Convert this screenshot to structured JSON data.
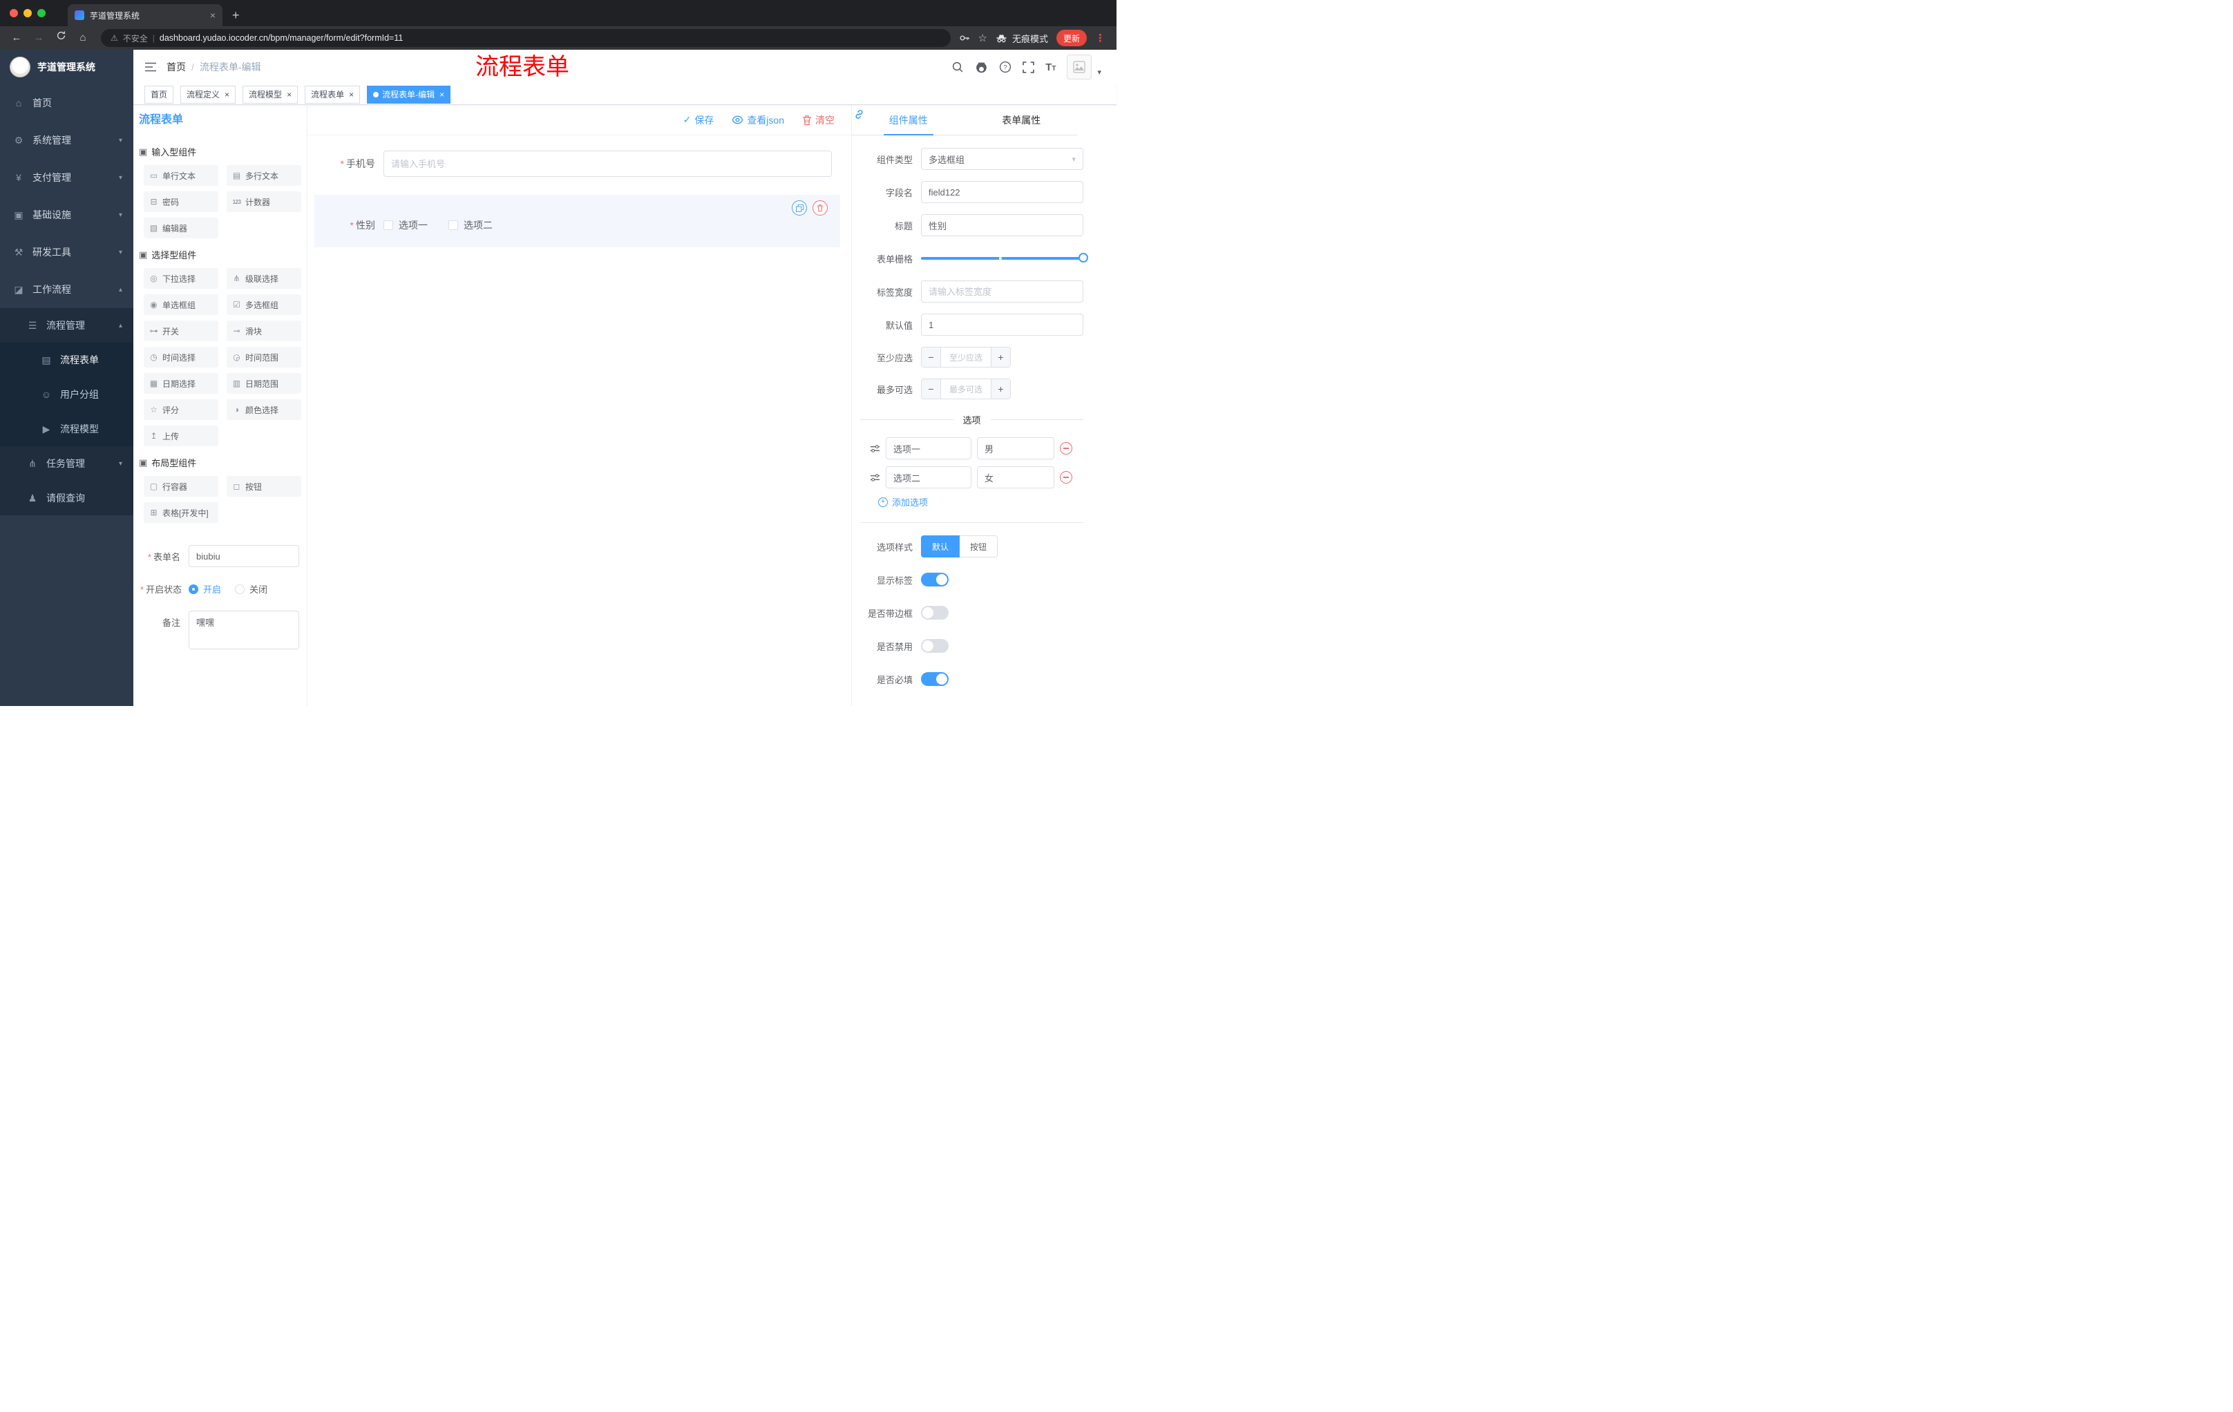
{
  "browser": {
    "tab_title": "芋道管理系统",
    "security_label": "不安全",
    "url": "dashboard.yudao.iocoder.cn/bpm/manager/form/edit?formId=11",
    "incognito_label": "无痕模式",
    "update_label": "更新"
  },
  "sidebar": {
    "logo_title": "芋道管理系统",
    "menu": [
      {
        "label": "首页",
        "icon": "⌂"
      },
      {
        "label": "系统管理",
        "icon": "⚙"
      },
      {
        "label": "支付管理",
        "icon": "¥"
      },
      {
        "label": "基础设施",
        "icon": "▣"
      },
      {
        "label": "研发工具",
        "icon": "⚒"
      },
      {
        "label": "工作流程",
        "icon": "◪"
      },
      {
        "label": "流程管理",
        "icon": "☰"
      },
      {
        "label": "流程表单",
        "icon": "▤"
      },
      {
        "label": "用户分组",
        "icon": "☺"
      },
      {
        "label": "流程模型",
        "icon": "▶"
      },
      {
        "label": "任务管理",
        "icon": "⋔"
      },
      {
        "label": "请假查询",
        "icon": "♟"
      }
    ]
  },
  "header": {
    "breadcrumb_home": "首页",
    "breadcrumb_current": "流程表单-编辑",
    "overlay_text": "流程表单"
  },
  "tags": [
    {
      "label": "首页"
    },
    {
      "label": "流程定义"
    },
    {
      "label": "流程模型"
    },
    {
      "label": "流程表单"
    },
    {
      "label": "流程表单-编辑"
    }
  ],
  "editor": {
    "panel_title": "流程表单",
    "save_label": "保存",
    "view_json_label": "查看json",
    "clear_label": "清空"
  },
  "palette": {
    "groups": [
      {
        "title": "输入型组件",
        "icon": "▣",
        "items": [
          {
            "label": "单行文本",
            "icon": "▭"
          },
          {
            "label": "多行文本",
            "icon": "▤"
          },
          {
            "label": "密码",
            "icon": "⊟"
          },
          {
            "label": "计数器",
            "icon": "123"
          },
          {
            "label": "编辑器",
            "icon": "▧"
          }
        ]
      },
      {
        "title": "选择型组件",
        "icon": "▣",
        "items": [
          {
            "label": "下拉选择",
            "icon": "◎"
          },
          {
            "label": "级联选择",
            "icon": "⋔"
          },
          {
            "label": "单选框组",
            "icon": "◉"
          },
          {
            "label": "多选框组",
            "icon": "☑"
          },
          {
            "label": "开关",
            "icon": "⊶"
          },
          {
            "label": "滑块",
            "icon": "⊸"
          },
          {
            "label": "时间选择",
            "icon": "◷"
          },
          {
            "label": "时间范围",
            "icon": "◶"
          },
          {
            "label": "日期选择",
            "icon": "▦"
          },
          {
            "label": "日期范围",
            "icon": "▥"
          },
          {
            "label": "评分",
            "icon": "☆"
          },
          {
            "label": "颜色选择",
            "icon": "◑"
          },
          {
            "label": "上传",
            "icon": "↥"
          }
        ]
      },
      {
        "title": "布局型组件",
        "icon": "▣",
        "items": [
          {
            "label": "行容器",
            "icon": "▢"
          },
          {
            "label": "按钮",
            "icon": "◻"
          },
          {
            "label": "表格[开发中]",
            "icon": "⊞"
          }
        ]
      }
    ]
  },
  "form_settings": {
    "name_label": "表单名",
    "name_value": "biubiu",
    "status_label": "开启状态",
    "status_on": "开启",
    "status_off": "关闭",
    "remark_label": "备注",
    "remark_value": "嘿嘿"
  },
  "canvas": {
    "phone_label": "手机号",
    "phone_placeholder": "请输入手机号",
    "gender_label": "性别",
    "gender_options": [
      "选项一",
      "选项二"
    ]
  },
  "props": {
    "tab_component": "组件属性",
    "tab_form": "表单属性",
    "component_type_label": "组件类型",
    "component_type_value": "多选框组",
    "field_name_label": "字段名",
    "field_name_value": "field122",
    "title_label": "标题",
    "title_value": "性别",
    "grid_label": "表单栅格",
    "label_width_label": "标签宽度",
    "label_width_placeholder": "请输入标签宽度",
    "default_label": "默认值",
    "default_value": "1",
    "min_label": "至少应选",
    "min_placeholder": "至少应选",
    "max_label": "最多可选",
    "max_placeholder": "最多可选",
    "options_title": "选项",
    "options": [
      {
        "label": "选项一",
        "value": "男"
      },
      {
        "label": "选项二",
        "value": "女"
      }
    ],
    "add_option_label": "添加选项",
    "style_label": "选项样式",
    "style_options": [
      "默认",
      "按钮"
    ],
    "style_selected": "默认",
    "switches": [
      {
        "label": "显示标签",
        "on": true
      },
      {
        "label": "是否带边框",
        "on": false
      },
      {
        "label": "是否禁用",
        "on": false
      },
      {
        "label": "是否必填",
        "on": true
      }
    ]
  },
  "colors": {
    "primary": "#409EFF",
    "danger": "#F56C6C",
    "annotation_red": "#FF0000"
  }
}
